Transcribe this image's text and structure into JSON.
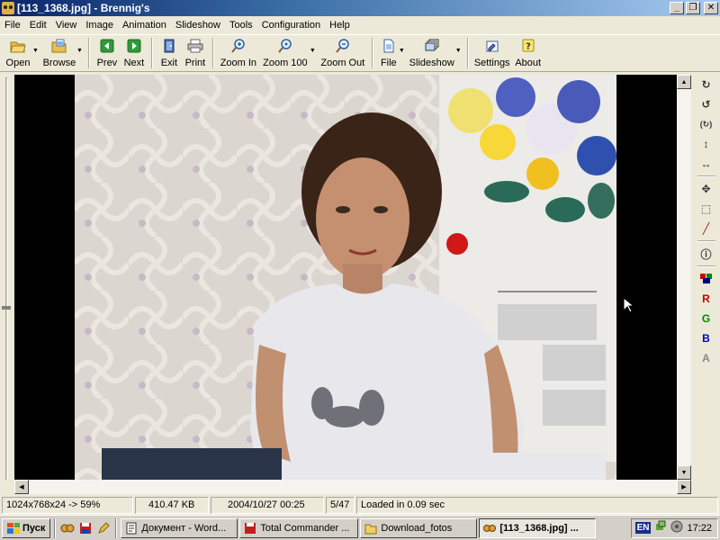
{
  "window": {
    "title": "[113_1368.jpg] - Brennig's"
  },
  "menu": [
    "File",
    "Edit",
    "View",
    "Image",
    "Animation",
    "Slideshow",
    "Tools",
    "Configuration",
    "Help"
  ],
  "toolbar": {
    "open": "Open",
    "browse": "Browse",
    "prev": "Prev",
    "next": "Next",
    "exit": "Exit",
    "print": "Print",
    "zoom_in": "Zoom In",
    "zoom_100": "Zoom 100",
    "zoom_out": "Zoom Out",
    "file": "File",
    "slideshow": "Slideshow",
    "settings": "Settings",
    "about": "About"
  },
  "tools_col": {
    "labels": {
      "red": "R",
      "green": "G",
      "blue": "B",
      "alpha": "A"
    },
    "colors": {
      "red": "#cc0000",
      "green": "#008800",
      "blue": "#0000cc",
      "alpha": "#888888"
    }
  },
  "status": {
    "dimensions": "1024x768x24 -> 59%",
    "filesize": "410.47 KB",
    "date": "2004/10/27 00:25",
    "index": "5/47",
    "message": "Loaded in 0.09 sec"
  },
  "taskbar": {
    "start": "Пуск",
    "tasks": [
      {
        "label": "Документ - Word...",
        "active": false
      },
      {
        "label": "Total Commander ...",
        "active": false
      },
      {
        "label": "Download_fotos",
        "active": false
      },
      {
        "label": "[113_1368.jpg] ...",
        "active": true
      }
    ],
    "lang": "EN",
    "clock": "17:22"
  },
  "colors": {
    "title_start": "#0a246a",
    "title_end": "#a6caf0",
    "face": "#ece9d8"
  }
}
